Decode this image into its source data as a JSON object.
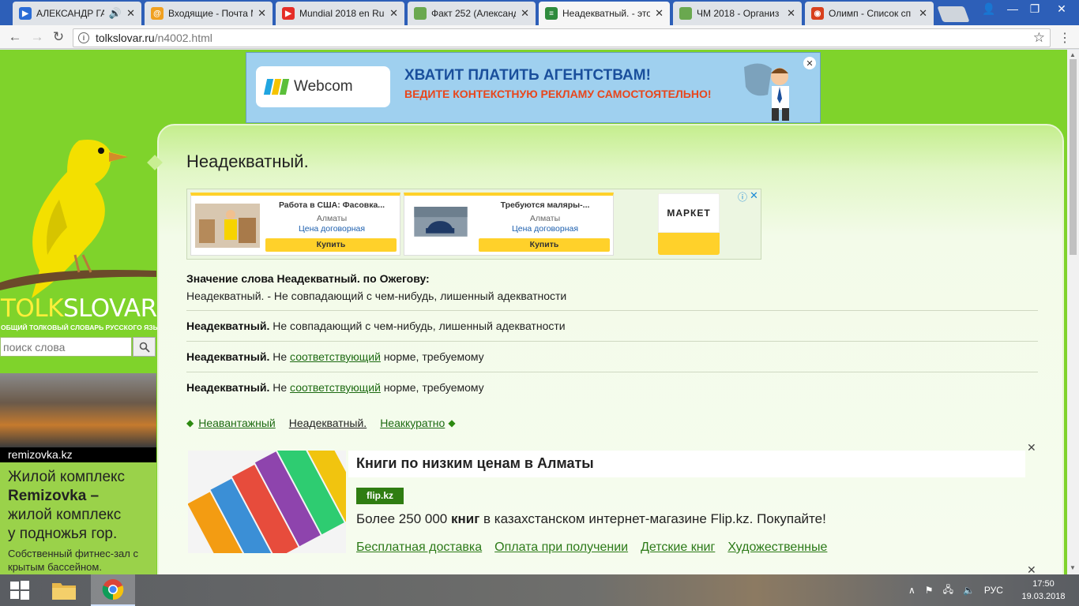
{
  "browser": {
    "tabs": [
      {
        "title": "АЛЕКСАНДР ГАЦ",
        "favicon": "youtube-music-icon",
        "color": "#2a6cd6",
        "audio": true
      },
      {
        "title": "Входящие - Почта М",
        "favicon": "mail-icon",
        "color": "#f0a020"
      },
      {
        "title": "Mundial 2018 en Ru",
        "favicon": "youtube-icon",
        "color": "#e52d27"
      },
      {
        "title": "Факт 252 (Александ",
        "favicon": "document-icon",
        "color": "#6aa84f"
      },
      {
        "title": "Неадекватный. - это",
        "favicon": "book-icon",
        "color": "#2e8b3d",
        "active": true
      },
      {
        "title": "ЧМ 2018 - Организ",
        "favicon": "document-icon",
        "color": "#6aa84f"
      },
      {
        "title": "Олимп - Список сп",
        "favicon": "olymp-icon",
        "color": "#d8401c"
      }
    ],
    "url_host": "tolkslovar.ru",
    "url_path": "/n4002.html"
  },
  "banner": {
    "logo": "Webcom",
    "line1": "ХВАТИТ ПЛАТИТЬ АГЕНТСТВАМ!",
    "line2": "ВЕДИТЕ КОНТЕКСТНУЮ РЕКЛАМУ САМОСТОЯТЕЛЬНО!",
    "close": "✕"
  },
  "site": {
    "logo_part1": "TOLK",
    "logo_part2": "SLOVAR.RU",
    "subtitle": "ОБЩИЙ ТОЛКОВЫЙ СЛОВАРЬ РУССКОГО ЯЗЫКА",
    "search_placeholder": "поиск слова"
  },
  "side_ad": {
    "domain": "remizovka.kz",
    "head_line1": "Жилой комплекс",
    "head_bold": "Remizovka –",
    "head_line3": "жилой комплекс",
    "head_line4": "у подножья гор.",
    "body": "Собственный фитнес-зал с крытым бассейном."
  },
  "page": {
    "title": "Неадекватный.",
    "def_title": "Значение слова Неадекватный. по Ожегову:",
    "def_text": "Неадекватный. - Не совпадающий с чем-нибудь, лишенный адекватности",
    "entries": [
      {
        "word": "Неадекватный.",
        "pre": " Не совпадающий с чем-нибудь, лишенный адекватности",
        "link": "",
        "post": ""
      },
      {
        "word": "Неадекватный.",
        "pre": " Не ",
        "link": "соответствующий",
        "post": " норме, требуемому"
      },
      {
        "word": "Неадекватный.",
        "pre": " Не ",
        "link": "соответствующий",
        "post": " норме, требуемому"
      }
    ],
    "prev": "Неавантажный",
    "current": "Неадекватный.",
    "next": "Неаккуратно"
  },
  "ads_row": {
    "items": [
      {
        "title": "Работа в США: Фасовка...",
        "city": "Алматы",
        "price": "Цена договорная",
        "button": "Купить"
      },
      {
        "title": "Требуются маляры-...",
        "city": "Алматы",
        "price": "Цена договорная",
        "button": "Купить"
      }
    ],
    "market_label": "МАРКЕТ"
  },
  "big_ad": {
    "title": "Книги по низким ценам в Алматы",
    "domain": "flip.kz",
    "text_pre": "Более 250 000 ",
    "text_bold": "книг",
    "text_post": " в казахстанском интернет-магазине Flip.kz. Покупайте!",
    "links": [
      "Бесплатная доставка",
      "Оплата при получении",
      "Детские книг",
      "Художественные"
    ]
  },
  "taskbar": {
    "lang": "РУС",
    "time": "17:50",
    "date": "19.03.2018"
  }
}
